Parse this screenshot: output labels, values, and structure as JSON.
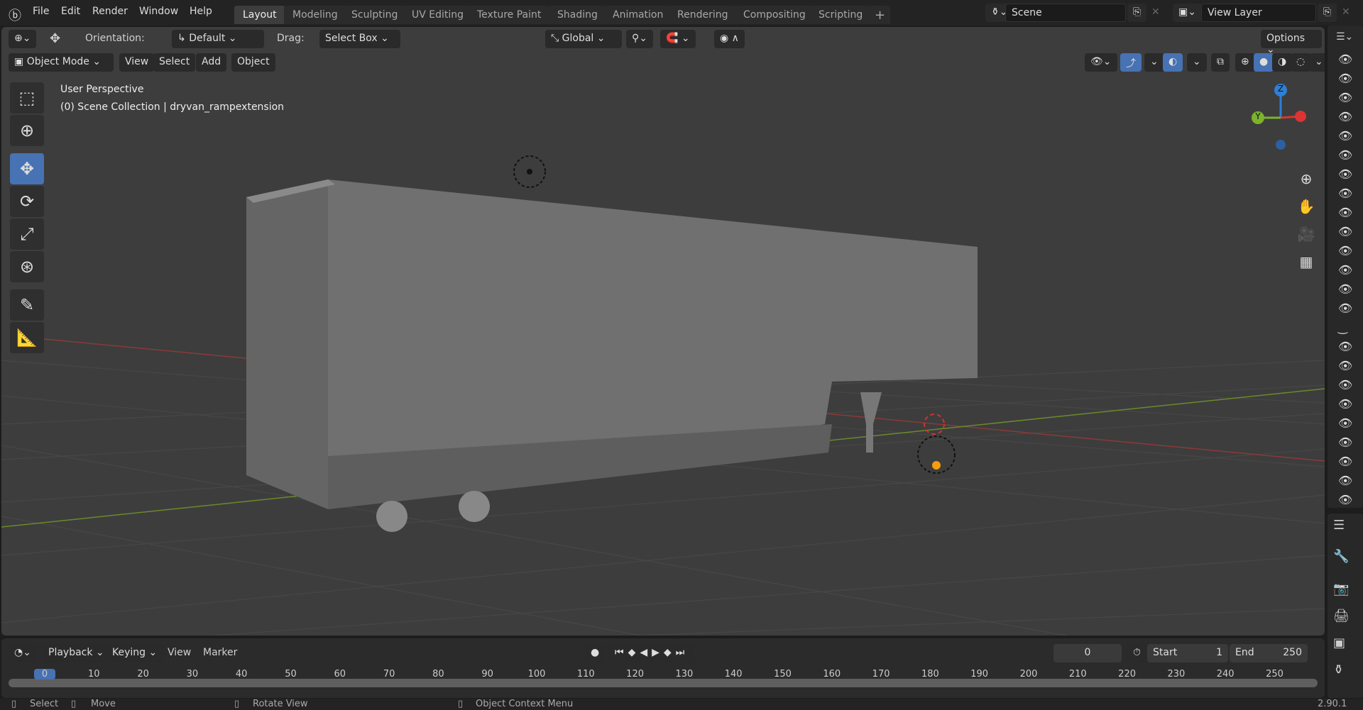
{
  "menu": [
    "File",
    "Edit",
    "Render",
    "Window",
    "Help"
  ],
  "workspaces": [
    "Layout",
    "Modeling",
    "Sculpting",
    "UV Editing",
    "Texture Paint",
    "Shading",
    "Animation",
    "Rendering",
    "Compositing",
    "Scripting"
  ],
  "scene": "Scene",
  "view_layer": "View Layer",
  "tool_header": {
    "orientation_label": "Orientation:",
    "orientation": "Default",
    "drag_label": "Drag:",
    "drag": "Select Box",
    "transform": "Global",
    "options": "Options"
  },
  "viewport_header": {
    "mode": "Object Mode",
    "menus": [
      "View",
      "Select",
      "Add",
      "Object"
    ]
  },
  "overlay": {
    "perspective": "User Perspective",
    "collection": "(0) Scene Collection | dryvan_rampextension"
  },
  "gizmo": {
    "z": "Z",
    "y": "Y"
  },
  "timeline": {
    "menus": [
      "Playback",
      "Keying",
      "View",
      "Marker"
    ],
    "current_frame": "0",
    "start_label": "Start",
    "start": "1",
    "end_label": "End",
    "end": "250",
    "ticks": [
      "0",
      "10",
      "20",
      "30",
      "40",
      "50",
      "60",
      "70",
      "80",
      "90",
      "100",
      "110",
      "120",
      "130",
      "140",
      "150",
      "160",
      "170",
      "180",
      "190",
      "200",
      "210",
      "220",
      "230",
      "240",
      "250"
    ]
  },
  "status": {
    "select": "Select",
    "move": "Move",
    "rotate": "Rotate View",
    "context": "Object Context Menu",
    "version": "2.90.1"
  },
  "colors": {
    "accent": "#4772b3",
    "viewport": "#3d3d3d"
  }
}
